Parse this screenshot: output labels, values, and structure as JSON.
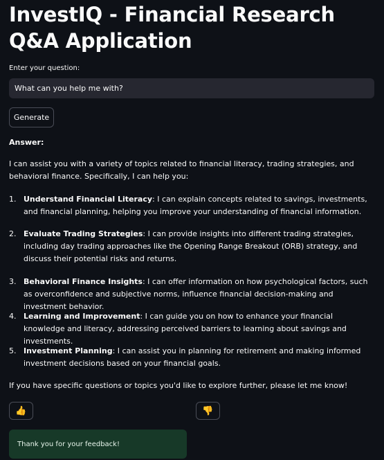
{
  "app": {
    "title": "InvestIQ - Financial Research Q&A Application"
  },
  "question": {
    "label": "Enter your question:",
    "value": "What can you help me with?"
  },
  "generate_button": {
    "label": "Generate"
  },
  "answer": {
    "heading": "Answer:",
    "intro": "I can assist you with a variety of topics related to financial literacy, trading strategies, and behavioral finance. Specifically, I can help you:",
    "items": [
      {
        "number": "1.",
        "lead": "Understand Financial Literacy",
        "text": ": I can explain concepts related to savings, investments, and financial planning, helping you improve your understanding of financial information."
      },
      {
        "number": "2.",
        "lead": "Evaluate Trading Strategies",
        "text": ": I can provide insights into different trading strategies, including day trading approaches like the Opening Range Breakout (ORB) strategy, and discuss their potential risks and returns."
      },
      {
        "number": "3.",
        "lead": "Behavioral Finance Insights",
        "text": ": I can offer information on how psychological factors, such as overconfidence and subjective norms, influence financial decision-making and investment behavior."
      },
      {
        "number": "4.",
        "lead": "Learning and Improvement",
        "text": ": I can guide you on how to enhance your financial knowledge and literacy, addressing perceived barriers to learning about savings and investments."
      },
      {
        "number": "5.",
        "lead": "Investment Planning",
        "text": ": I can assist you in planning for retirement and making informed investment decisions based on your financial goals."
      }
    ],
    "outro": "If you have specific questions or topics you'd like to explore further, please let me know!"
  },
  "feedback": {
    "thumbs_up": "👍",
    "thumbs_down": "👎",
    "success_message": "Thank you for your feedback!"
  },
  "colors": {
    "background": "#0e1117",
    "input_background": "#262730",
    "success_background": "#173928",
    "text": "#fafafa"
  },
  "icons": {
    "thumbs_up": "thumbs-up-icon",
    "thumbs_down": "thumbs-down-icon"
  }
}
